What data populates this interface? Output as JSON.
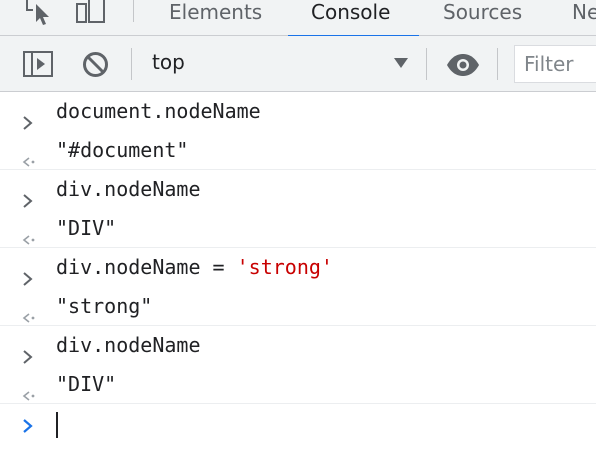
{
  "tabs": [
    {
      "label": "Elements",
      "active": false
    },
    {
      "label": "Console",
      "active": true
    },
    {
      "label": "Sources",
      "active": false
    },
    {
      "label": "Ne",
      "active": false
    }
  ],
  "toolbar": {
    "context": "top",
    "filter_placeholder": "Filter"
  },
  "console": {
    "entries": [
      {
        "kind": "input",
        "text": "document.nodeName"
      },
      {
        "kind": "output",
        "text": "\"#document\""
      },
      {
        "kind": "input",
        "text": "div.nodeName"
      },
      {
        "kind": "output",
        "text": "\"DIV\""
      },
      {
        "kind": "input",
        "text_prefix": "div.nodeName",
        "operator": " = ",
        "string": "'strong'"
      },
      {
        "kind": "output",
        "text": "\"strong\""
      },
      {
        "kind": "input",
        "text": "div.nodeName"
      },
      {
        "kind": "output",
        "text": "\"DIV\""
      }
    ]
  },
  "colors": {
    "accent": "#1a73e8",
    "string": "#c80000",
    "toolbar_bg": "#f1f3f4",
    "icon": "#5f6368"
  }
}
